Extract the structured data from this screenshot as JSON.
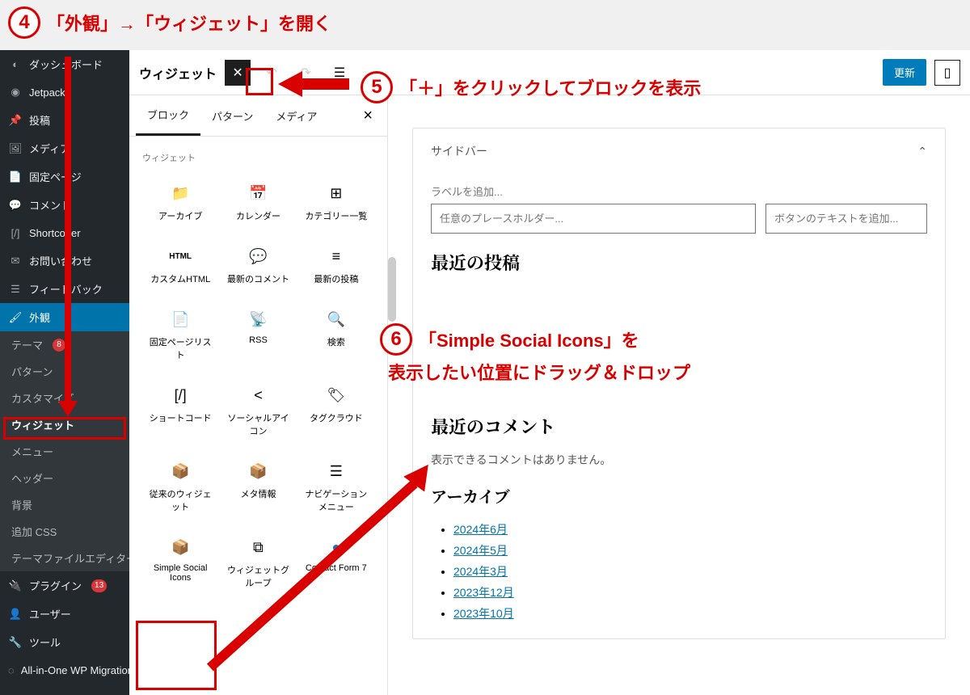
{
  "annotations": {
    "step4": {
      "num": "4",
      "text": "「外観」→「ウィジェット」を開く"
    },
    "step5": {
      "num": "5",
      "text": "「＋」をクリックしてブロックを表示"
    },
    "step6": {
      "num": "6",
      "text_l1": "「Simple Social Icons」を",
      "text_l2": "表示したい位置にドラッグ＆ドロップ"
    }
  },
  "sidebar": {
    "items": [
      {
        "icon": "dashboard",
        "label": "ダッシュボード"
      },
      {
        "icon": "jetpack",
        "label": "Jetpack"
      },
      {
        "icon": "pin",
        "label": "投稿"
      },
      {
        "icon": "media",
        "label": "メディア"
      },
      {
        "icon": "page",
        "label": "固定ページ"
      },
      {
        "icon": "comment",
        "label": "コメント"
      },
      {
        "icon": "shortcode",
        "label": "Shortcoder"
      },
      {
        "icon": "mail",
        "label": "お問い合わせ"
      },
      {
        "icon": "feedback",
        "label": "フィードバック"
      },
      {
        "icon": "brush",
        "label": "外観",
        "active": true
      },
      {
        "icon": "plugin",
        "label": "プラグイン",
        "badge": "13"
      },
      {
        "icon": "user",
        "label": "ユーザー"
      },
      {
        "icon": "tool",
        "label": "ツール"
      },
      {
        "icon": "migration",
        "label": "All-in-One WP Migration"
      }
    ],
    "sub": [
      {
        "label": "テーマ",
        "badge": "8"
      },
      {
        "label": "パターン"
      },
      {
        "label": "カスタマイズ"
      },
      {
        "label": "ウィジェット",
        "current": true
      },
      {
        "label": "メニュー"
      },
      {
        "label": "ヘッダー"
      },
      {
        "label": "背景"
      },
      {
        "label": "追加 CSS"
      },
      {
        "label": "テーマファイルエディター"
      }
    ]
  },
  "topbar": {
    "title": "ウィジェット",
    "update": "更新"
  },
  "inserter": {
    "tabs": [
      "ブロック",
      "パターン",
      "メディア"
    ],
    "category": "ウィジェット",
    "blocks": [
      {
        "icon": "📁",
        "label": "アーカイブ"
      },
      {
        "icon": "📅",
        "label": "カレンダー"
      },
      {
        "icon": "⊞",
        "label": "カテゴリー一覧"
      },
      {
        "icon": "HTML",
        "label": "カスタムHTML"
      },
      {
        "icon": "💬",
        "label": "最新のコメント"
      },
      {
        "icon": "≡",
        "label": "最新の投稿"
      },
      {
        "icon": "📄",
        "label": "固定ページリスト"
      },
      {
        "icon": "📡",
        "label": "RSS"
      },
      {
        "icon": "🔍",
        "label": "検索"
      },
      {
        "icon": "[/]",
        "label": "ショートコード"
      },
      {
        "icon": "<",
        "label": "ソーシャルアイコン"
      },
      {
        "icon": "🏷",
        "label": "タグクラウド"
      },
      {
        "icon": "📦",
        "label": "従来のウィジェット"
      },
      {
        "icon": "📦",
        "label": "メタ情報"
      },
      {
        "icon": "☰",
        "label": "ナビゲーションメニュー"
      },
      {
        "icon": "📦",
        "label": "Simple Social Icons"
      },
      {
        "icon": "⧉",
        "label": "ウィジェットグループ"
      },
      {
        "icon": "●",
        "label": "Contact Form 7"
      }
    ]
  },
  "canvas": {
    "area_title": "サイドバー",
    "label_add": "ラベルを追加...",
    "placeholder": "任意のプレースホルダー...",
    "button_text_placeholder": "ボタンのテキストを追加...",
    "h2_recent_posts": "最近の投稿",
    "h2_recent_comments": "最近のコメント",
    "no_comments": "表示できるコメントはありません。",
    "h3_archive": "アーカイブ",
    "archive_links": [
      "2024年6月",
      "2024年5月",
      "2024年3月",
      "2023年12月",
      "2023年10月"
    ]
  }
}
